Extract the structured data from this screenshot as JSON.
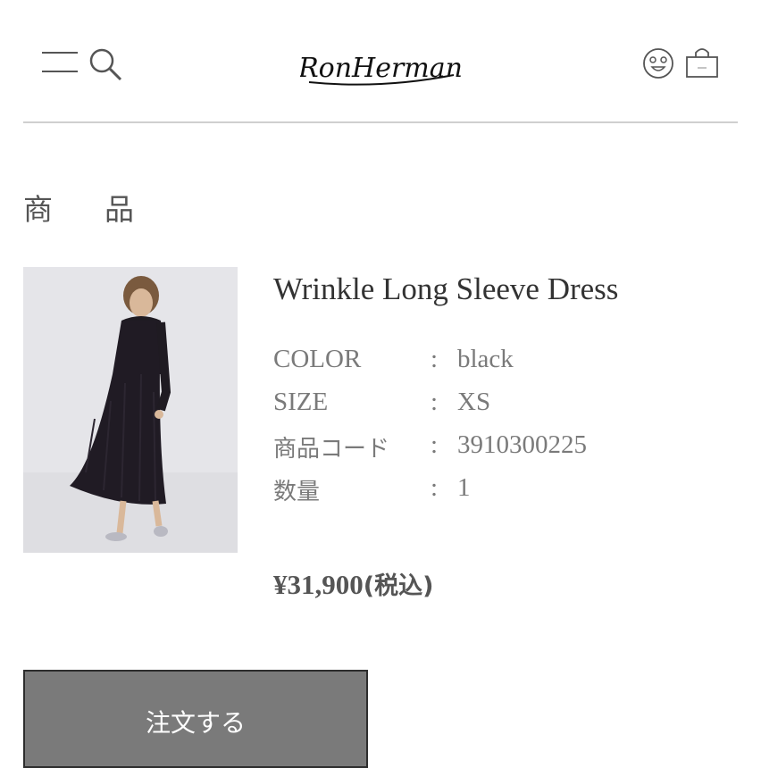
{
  "header": {
    "brand": "RonHerman",
    "icons": [
      "menu-icon",
      "search-icon",
      "account-icon",
      "shopping-bag-icon"
    ]
  },
  "section": {
    "heading": "商品"
  },
  "product": {
    "name": "Wrinkle Long Sleeve Dress",
    "attributes": [
      {
        "label": "COLOR",
        "colon": ":",
        "value": "black"
      },
      {
        "label": "SIZE",
        "colon": ":",
        "value": "XS"
      },
      {
        "label": "商品コード",
        "colon": ":",
        "value": "3910300225"
      },
      {
        "label": "数量",
        "colon": ":",
        "value": "1"
      }
    ],
    "price": "¥31,900",
    "tax_note": "(税込)"
  },
  "actions": {
    "order_label": "注文する"
  },
  "colors": {
    "button_bg": "#7a7a7a",
    "divider": "#cfcfcf",
    "text_gray": "#7a7a7a"
  }
}
